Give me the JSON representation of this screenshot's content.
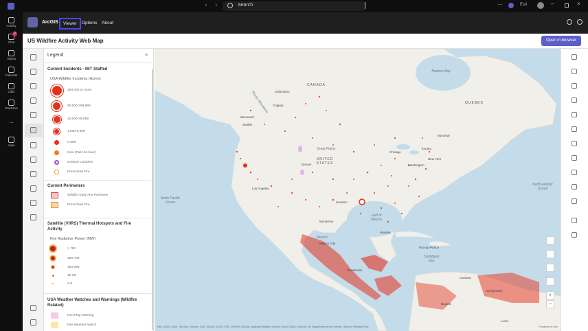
{
  "titlebar": {
    "search_placeholder": "Search",
    "user_name": "Esri",
    "nav_back": "‹",
    "nav_forward": "›"
  },
  "rail": {
    "items": [
      {
        "label": "Activity",
        "icon": "bell-icon"
      },
      {
        "label": "Chat",
        "icon": "chat-icon",
        "badge": "2"
      },
      {
        "label": "Teams",
        "icon": "teams-icon"
      },
      {
        "label": "Calendar",
        "icon": "calendar-icon"
      },
      {
        "label": "Calls",
        "icon": "phone-icon"
      },
      {
        "label": "OneDrive",
        "icon": "cloud-icon"
      },
      {
        "label": "...",
        "icon": "more-icon"
      },
      {
        "label": "Apps",
        "icon": "apps-icon"
      }
    ]
  },
  "app": {
    "name": "ArcGIS",
    "tabs": [
      "Viewer",
      "Options",
      "About"
    ],
    "active_tab": "Viewer"
  },
  "content": {
    "title": "US Wildfire Activity Web Map",
    "open_browser": "Open in browser"
  },
  "legend": {
    "header": "Legend",
    "close": "×",
    "sections": {
      "incidents_title": "Current Incidents - IMT Staffed",
      "incidents_sub": "USA Wildfire Incidents (Acres)",
      "incident_rows": [
        "300,000 or more",
        "50,000-299,999",
        "10,000-49,999",
        "1,000-9,999",
        "0-999",
        "New (Past 24-hour)",
        "Incident Complex",
        "Prescribed Fire"
      ],
      "perimeters_title": "Current Perimeters",
      "perimeter_rows": [
        "Wildfire Daily Fire Perimeter",
        "Prescribed Fire"
      ],
      "viirs_title": "Satellite (VIIRS) Thermal Hotspots and Fire Activity",
      "viirs_sub": "Fire Radiative Power (MW)",
      "viirs_rows": [
        "> 750",
        "300-749",
        "100-299",
        "10-99",
        "0-9"
      ],
      "weather_title": "USA Weather Watches and Warnings (Wildfire Related)",
      "weather_rows": [
        "Red Flag Warning",
        "Fire Weather Watch"
      ]
    }
  },
  "map": {
    "labels": {
      "canada": "CANADA",
      "united_states": "UNITED STATES",
      "mexico": "Mexico",
      "edmonton": "Edmonton",
      "calgary": "Calgary",
      "vancouver": "Vancouver",
      "seattle": "Seattle",
      "los_angeles": "Los Angeles",
      "denver": "Denver",
      "chicago": "Chicago",
      "toronto": "Toronto",
      "montreal": "Montreal",
      "new_york": "New York",
      "washington": "Washington",
      "houston": "Houston",
      "havana": "Havana",
      "monterrey": "Monterrey",
      "mexico_city": "Mexico City",
      "guatemala": "Guatemala",
      "port_au_prince": "Port-au-Prince",
      "caracas": "Caracas",
      "bogota": "Bogotá",
      "georgetown": "Georgetown",
      "great_plains": "Great Plains",
      "north_pacific": "North Pacific Ocean",
      "north_atlantic": "North Atlantic Ocean",
      "gulf": "Gulf of Mexico",
      "caribbean": "Caribbean Sea",
      "hudson_bay": "Hudson Bay",
      "rocky_mountains": "Rocky Mountains",
      "quebec": "QUEBEC",
      "lima": "Lima"
    },
    "attribution": "Esri, USGS | Esri, TomTom, Garmin, FAO, NOAA, USGS, EPA, USFWS | NOAA, National Weather Service, Esri | NASA | Source: US Department of the Interior, Office of Wildland Fire",
    "powered": "Powered by Esri"
  },
  "colors": {
    "accent": "#5b5fc7",
    "fire_red": "#e5321e",
    "fire_orange": "#f5a05a",
    "land": "#f0efe9",
    "water": "#c4dcea"
  }
}
